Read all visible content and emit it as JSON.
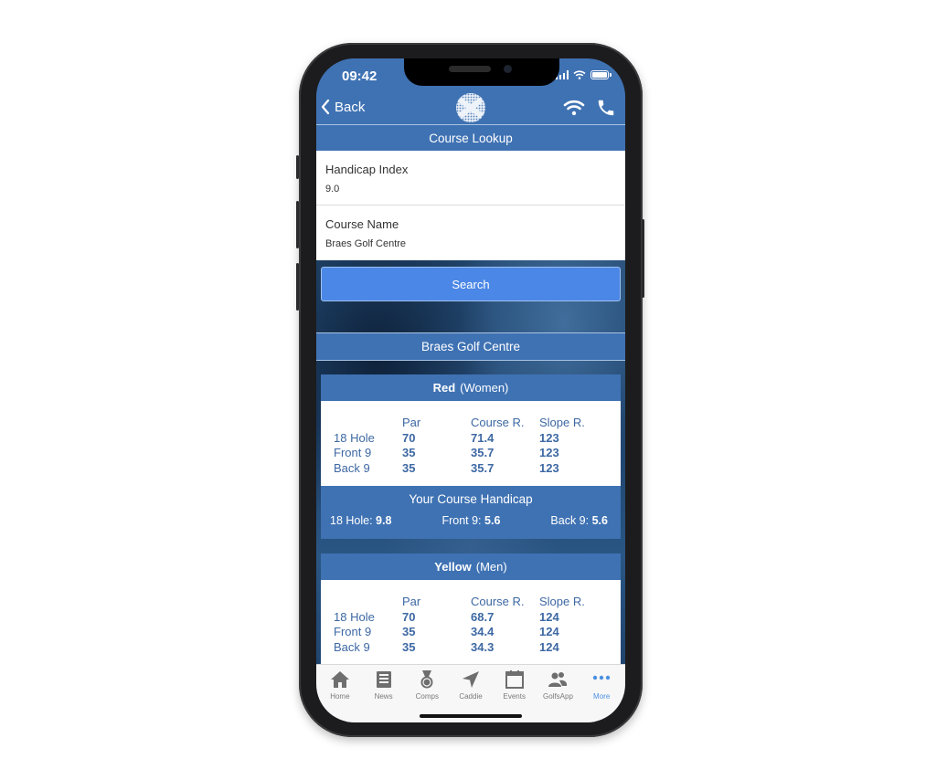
{
  "status_bar": {
    "time": "09:42"
  },
  "header": {
    "back_label": "Back",
    "logo": "saltire-golf-ball-logo",
    "icons": [
      "wifi-icon",
      "phone-icon"
    ]
  },
  "course_lookup": {
    "title": "Course Lookup",
    "handicap_label": "Handicap Index",
    "handicap_value": "9.0",
    "course_label": "Course Name",
    "course_value": "Braes Golf Centre",
    "search_label": "Search"
  },
  "results": {
    "course_title": "Braes Golf Centre",
    "columns": [
      "",
      "Par",
      "Course R.",
      "Slope R."
    ],
    "tees": [
      {
        "colour": "Red",
        "gender": "(Women)",
        "rows": [
          {
            "label": "18 Hole",
            "par": "70",
            "course_rating": "71.4",
            "slope_rating": "123"
          },
          {
            "label": "Front 9",
            "par": "35",
            "course_rating": "35.7",
            "slope_rating": "123"
          },
          {
            "label": "Back 9",
            "par": "35",
            "course_rating": "35.7",
            "slope_rating": "123"
          }
        ],
        "course_handicap": {
          "title": "Your Course Handicap",
          "hole18_label": "18 Hole:",
          "hole18_value": "9.8",
          "front9_label": "Front 9:",
          "front9_value": "5.6",
          "back9_label": "Back 9:",
          "back9_value": "5.6"
        }
      },
      {
        "colour": "Yellow",
        "gender": "(Men)",
        "rows": [
          {
            "label": "18 Hole",
            "par": "70",
            "course_rating": "68.7",
            "slope_rating": "124"
          },
          {
            "label": "Front 9",
            "par": "35",
            "course_rating": "34.4",
            "slope_rating": "124"
          },
          {
            "label": "Back 9",
            "par": "35",
            "course_rating": "34.3",
            "slope_rating": "124"
          }
        ]
      }
    ]
  },
  "tabbar": {
    "items": [
      {
        "label": "Home",
        "icon": "home-icon"
      },
      {
        "label": "News",
        "icon": "news-icon"
      },
      {
        "label": "Comps",
        "icon": "medal-icon"
      },
      {
        "label": "Caddie",
        "icon": "navigation-arrow-icon"
      },
      {
        "label": "Events",
        "icon": "calendar-icon"
      },
      {
        "label": "GolfsApp",
        "icon": "users-icon"
      },
      {
        "label": "More",
        "icon": "more-dots-icon"
      }
    ],
    "active": "More"
  },
  "colors": {
    "brand_blue": "#3f72b3",
    "button_blue": "#4b87e6",
    "table_text": "#3d68a3",
    "tab_active": "#4a90e2"
  }
}
